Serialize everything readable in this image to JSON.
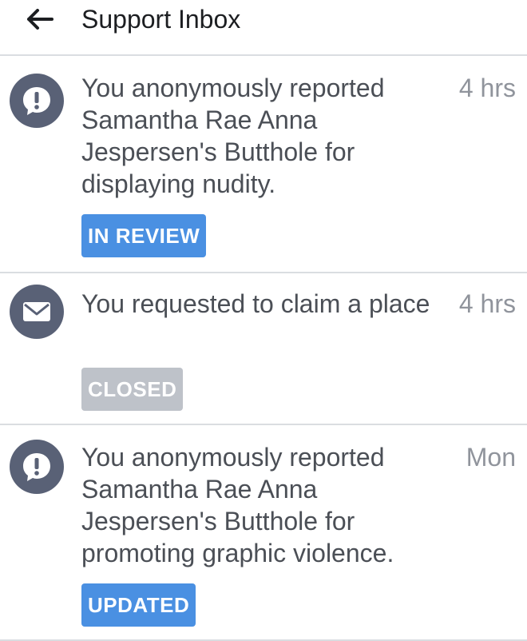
{
  "header": {
    "title": "Support Inbox",
    "back_icon": "arrow-left-icon"
  },
  "items": [
    {
      "icon": "alert-bubble-icon",
      "message": "You anonymously reported Samantha Rae Anna Jespersen's Butthole for displaying nudity.",
      "time": "4 hrs",
      "status": "IN REVIEW",
      "status_color": "#4a90e2"
    },
    {
      "icon": "envelope-icon",
      "message": "You requested to claim a place",
      "time": "4 hrs",
      "status": "CLOSED",
      "status_color": "#bec2c9"
    },
    {
      "icon": "alert-bubble-icon",
      "message": "You anonymously reported Samantha Rae Anna Jespersen's Butthole for promoting graphic violence.",
      "time": "Mon",
      "status": "UPDATED",
      "status_color": "#4a90e2"
    }
  ]
}
